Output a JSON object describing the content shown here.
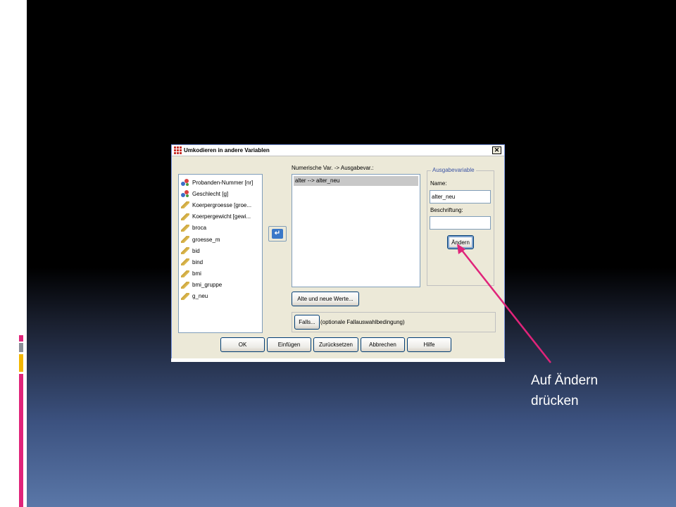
{
  "dialog": {
    "title": "Umkodieren in andere Variablen",
    "close_glyph": "✕",
    "variables": [
      {
        "label": "Probanden-Nummer [nr]",
        "icon": "nominal-icon"
      },
      {
        "label": "Geschlecht [g]",
        "icon": "nominal-icon"
      },
      {
        "label": "Koerpergroesse [groe...",
        "icon": "scale-icon"
      },
      {
        "label": "Koerpergewicht [gewi...",
        "icon": "scale-icon"
      },
      {
        "label": "broca",
        "icon": "scale-icon"
      },
      {
        "label": "groesse_m",
        "icon": "scale-icon"
      },
      {
        "label": "bid",
        "icon": "scale-icon"
      },
      {
        "label": "bind",
        "icon": "scale-icon"
      },
      {
        "label": "bmi",
        "icon": "scale-icon"
      },
      {
        "label": "bmi_gruppe",
        "icon": "scale-icon"
      },
      {
        "label": "g_neu",
        "icon": "scale-icon"
      }
    ],
    "move_arrow_glyph": "↵",
    "mapping_label": "Numerische Var. -> Ausgabevar.:",
    "mapping_rows": [
      "alter --> alter_neu"
    ],
    "output_group_title": "Ausgabevariable",
    "name_label": "Name:",
    "name_value": "alter_neu",
    "caption_label": "Beschriftung:",
    "caption_value": "",
    "change_button": "Ändern",
    "old_new_button": "Alte und neue Werte...",
    "if_button": "Falls...",
    "if_hint": "(optionale Fallauswahlbedingung)",
    "buttons": {
      "ok": "OK",
      "paste": "Einfügen",
      "reset": "Zurücksetzen",
      "cancel": "Abbrechen",
      "help": "Hilfe"
    }
  },
  "annotation": {
    "line1": "Auf Ändern",
    "line2": "drücken",
    "arrow_color": "#e0247a"
  },
  "colors": {
    "deco_magenta": "#e0247a",
    "deco_gray": "#8a8f98",
    "deco_yellow": "#f2b600"
  }
}
